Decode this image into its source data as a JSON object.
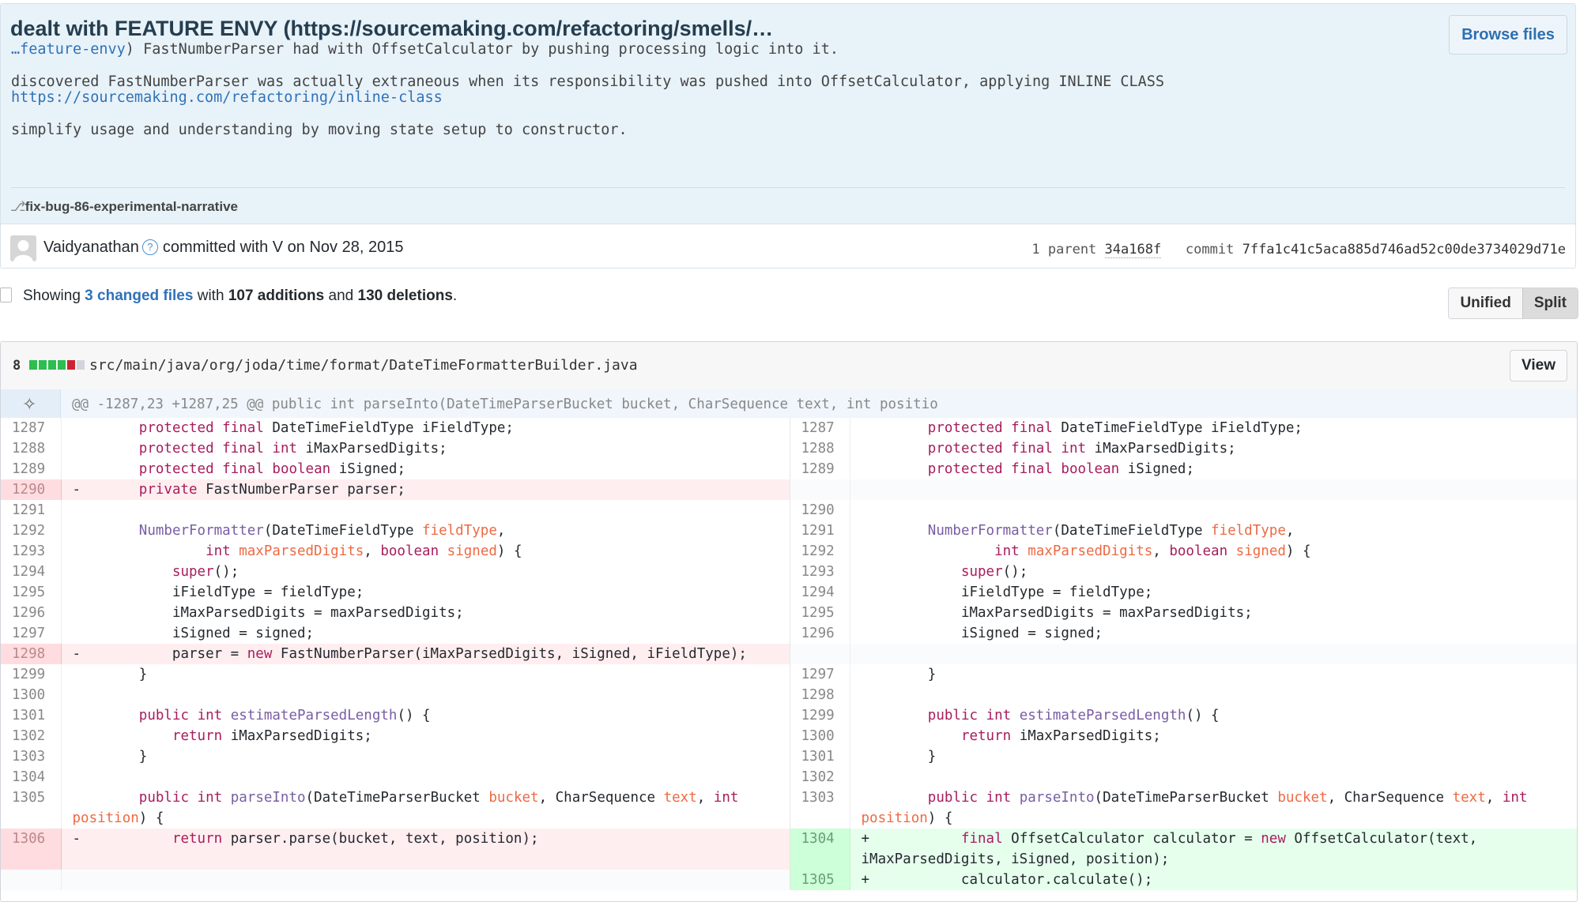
{
  "commit": {
    "title": "dealt with FEATURE ENVY (https://sourcemaking.com/refactoring/smells/…",
    "browse_files": "Browse files",
    "desc_link_prefix": "…feature-envy",
    "desc_line1_rest": ") FastNumberParser had with OffsetCalculator by pushing processing logic into it.",
    "desc_line2": "discovered FastNumberParser was actually extraneous when its responsibility was pushed into OffsetCalculator, applying INLINE CLASS",
    "desc_line3_link": "https://sourcemaking.com/refactoring/inline-class",
    "desc_line4": "simplify usage and understanding by moving state setup to constructor.",
    "branch": "fix-bug-86-experimental-narrative",
    "author": "Vaidyanathan",
    "committed_with": "committed with V on Nov 28, 2015",
    "parent_label": "1 parent",
    "parent_sha": "34a168f",
    "commit_label": "commit",
    "commit_sha": "7ffa1c41c5aca885d746ad52c00de3734029d71e"
  },
  "summary": {
    "showing": "Showing",
    "changed_files": "3 changed files",
    "with": "with",
    "additions": "107 additions",
    "and": "and",
    "deletions": "130 deletions",
    "period": ".",
    "unified": "Unified",
    "split": "Split"
  },
  "file": {
    "count": "8",
    "path": "src/main/java/org/joda/time/format/DateTimeFormatterBuilder.java",
    "view": "View",
    "diffstat_colors": [
      "#2cbe4e",
      "#2cbe4e",
      "#2cbe4e",
      "#2cbe4e",
      "#cb2431",
      "#d1d5da"
    ],
    "hunk": "@@ -1287,23 +1287,25 @@ public int parseInto(DateTimeParserBucket bucket, CharSequence text, int positio"
  },
  "diff_rows": [
    {
      "ln": "1287",
      "lt": "del0",
      "lc": "        protected final DateTimeFieldType iFieldType;",
      "rn": "1287",
      "rc": "        protected final DateTimeFieldType iFieldType;"
    },
    {
      "ln": "1288",
      "lc": "        protected final int iMaxParsedDigits;",
      "rn": "1288",
      "rc": "        protected final int iMaxParsedDigits;"
    },
    {
      "ln": "1289",
      "lc": "        protected final boolean iSigned;",
      "rn": "1289",
      "rc": "        protected final boolean iSigned;"
    },
    {
      "ln": "1290",
      "lt": "del",
      "lc": "-       private FastNumberParser parser;",
      "rn": "",
      "rt": "empty",
      "rc": ""
    },
    {
      "ln": "1291",
      "lc": "",
      "rn": "1290",
      "rc": ""
    },
    {
      "ln": "1292",
      "lc": "        NumberFormatter(DateTimeFieldType fieldType,",
      "rn": "1291",
      "rc": "        NumberFormatter(DateTimeFieldType fieldType,"
    },
    {
      "ln": "1293",
      "lc": "                int maxParsedDigits, boolean signed) {",
      "rn": "1292",
      "rc": "                int maxParsedDigits, boolean signed) {"
    },
    {
      "ln": "1294",
      "lc": "            super();",
      "rn": "1293",
      "rc": "            super();"
    },
    {
      "ln": "1295",
      "lc": "            iFieldType = fieldType;",
      "rn": "1294",
      "rc": "            iFieldType = fieldType;"
    },
    {
      "ln": "1296",
      "lc": "            iMaxParsedDigits = maxParsedDigits;",
      "rn": "1295",
      "rc": "            iMaxParsedDigits = maxParsedDigits;"
    },
    {
      "ln": "1297",
      "lc": "            iSigned = signed;",
      "rn": "1296",
      "rc": "            iSigned = signed;"
    },
    {
      "ln": "1298",
      "lt": "del",
      "lc": "-           parser = new FastNumberParser(iMaxParsedDigits, iSigned, iFieldType);",
      "rn": "",
      "rt": "empty",
      "rc": ""
    },
    {
      "ln": "1299",
      "lc": "        }",
      "rn": "1297",
      "rc": "        }"
    },
    {
      "ln": "1300",
      "lc": "",
      "rn": "1298",
      "rc": ""
    },
    {
      "ln": "1301",
      "lc": "        public int estimateParsedLength() {",
      "rn": "1299",
      "rc": "        public int estimateParsedLength() {"
    },
    {
      "ln": "1302",
      "lc": "            return iMaxParsedDigits;",
      "rn": "1300",
      "rc": "            return iMaxParsedDigits;"
    },
    {
      "ln": "1303",
      "lc": "        }",
      "rn": "1301",
      "rc": "        }"
    },
    {
      "ln": "1304",
      "lc": "",
      "rn": "1302",
      "rc": ""
    },
    {
      "ln": "1305",
      "lc": "        public int parseInto(DateTimeParserBucket bucket, CharSequence text, int position) {",
      "rn": "1303",
      "rc": "        public int parseInto(DateTimeParserBucket bucket, CharSequence text, int position) {"
    },
    {
      "ln": "1306",
      "lt": "del",
      "lc": "-           return parser.parse(bucket, text, position);",
      "rn": "1304",
      "rt": "add",
      "rc": "+           final OffsetCalculator calculator = new OffsetCalculator(text, iMaxParsedDigits, iSigned, position);"
    },
    {
      "ln": "",
      "lt": "empty",
      "lc": "",
      "rn": "1305",
      "rt": "add",
      "rc": "+           calculator.calculate();"
    }
  ]
}
